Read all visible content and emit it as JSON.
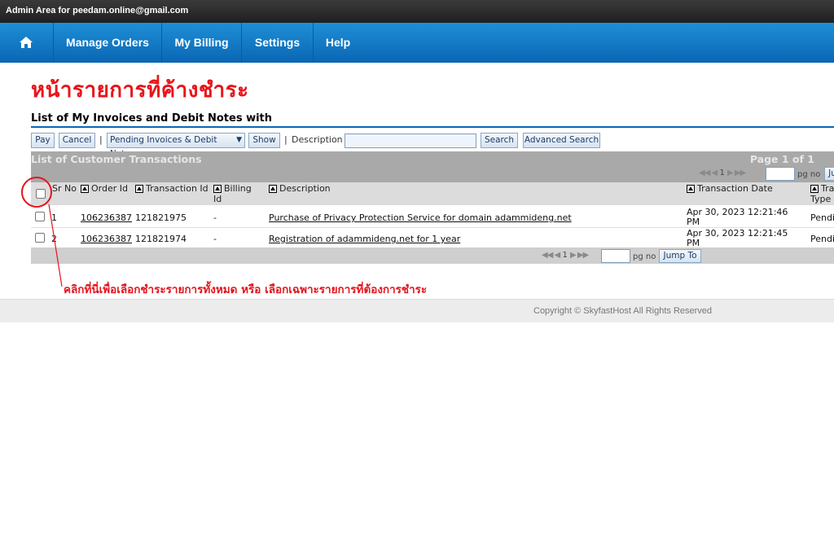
{
  "topbar": {
    "text": "Admin Area for peedam.online@gmail.com"
  },
  "nav": {
    "home_icon": "home-icon",
    "items": [
      {
        "label": "Manage Orders"
      },
      {
        "label": "My Billing"
      },
      {
        "label": "Settings"
      },
      {
        "label": "Help"
      }
    ]
  },
  "annotation_title": "หน้ารายการที่ค้างชำระ",
  "list_title": "List of My Invoices and Debit Notes with",
  "toolbar": {
    "pay": "Pay",
    "cancel": "Cancel",
    "separator": "|",
    "filter_value": "Pending Invoices & Debit Notes",
    "show": "Show",
    "description_label": "Description",
    "description_value": "",
    "search": "Search",
    "advanced_search": "Advanced Search"
  },
  "panel": {
    "title": "List of Customer Transactions",
    "page_info": "Page 1 of 1",
    "pager_top": {
      "arrows_left": "◀◀ ◀",
      "page": "1",
      "arrows_right": "▶ ▶▶",
      "pg_no": "pg no",
      "jump_partial": "Ju"
    },
    "pager_bottom": {
      "arrows_left": "◀◀ ◀",
      "page": "1",
      "arrows_right": "▶ ▶▶",
      "pg_no": "pg no",
      "jump": "Jump To"
    }
  },
  "columns": {
    "sr_no": "Sr No",
    "order_id": "Order Id",
    "transaction_id": "Transaction Id",
    "billing_id": "Billing Id",
    "description": "Description",
    "transaction_date": "Transaction Date",
    "transaction_type": "Tra Type"
  },
  "rows": [
    {
      "sr": "1",
      "order_id": "106236387",
      "transaction_id": "121821975",
      "billing_id": "-",
      "description": "Purchase of Privacy Protection Service for domain adammideng.net",
      "date_line1": "Apr 30, 2023 12:21:46",
      "date_line2": "PM",
      "type": "Pendi"
    },
    {
      "sr": "2",
      "order_id": "106236387",
      "transaction_id": "121821974",
      "billing_id": "-",
      "description": "Registration of adammideng.net for 1 year",
      "date_line1": "Apr 30, 2023 12:21:45",
      "date_line2": "PM",
      "type": "Pendi"
    }
  ],
  "annotation_note": "คลิกที่นี่เพื่อเลือกชำระรายการทั้งหมด หรือ เลือกเฉพาะรายการที่ต้องการชำระ",
  "footer": {
    "copyright": "Copyright © SkyfastHost All Rights Reserved"
  },
  "colors": {
    "nav_blue": "#0a66b4",
    "annotation_red": "#e5141c"
  }
}
